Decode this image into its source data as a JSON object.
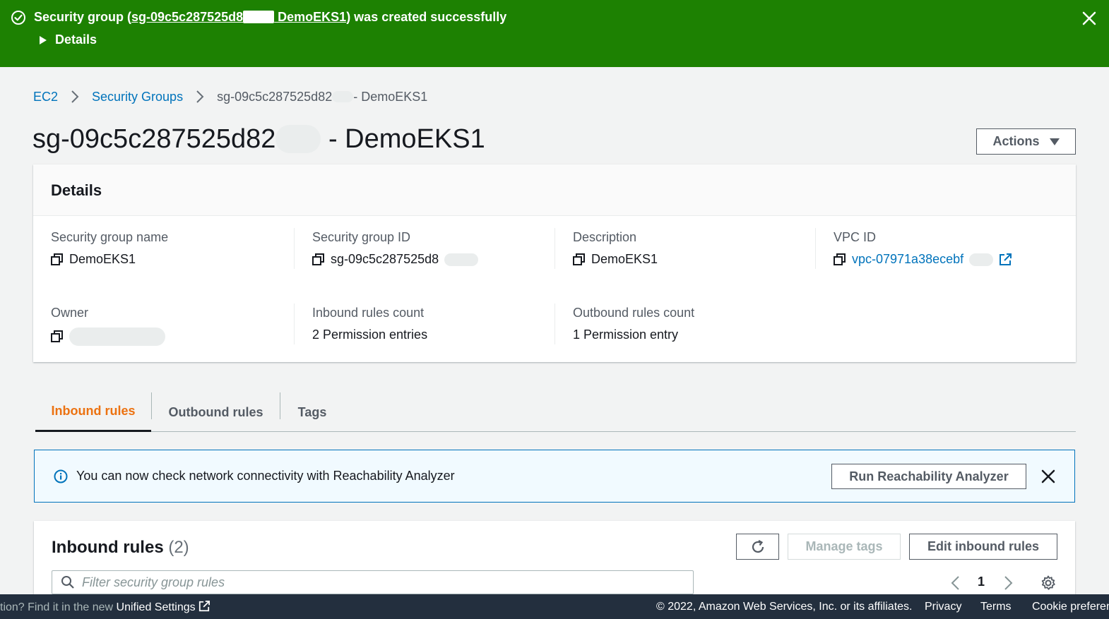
{
  "flash": {
    "prefix": "Security group (",
    "link_part1": "sg-09c5c287525d8",
    "link_part2": " DemoEKS1",
    "suffix": ") was created successfully",
    "details_label": "Details"
  },
  "breadcrumb": {
    "items": [
      "EC2",
      "Security Groups"
    ],
    "current_part1": "sg-09c5c287525d82",
    "current_part2": "- DemoEKS1"
  },
  "page": {
    "title_part1": "sg-09c5c287525d82",
    "title_part2": " - DemoEKS1",
    "actions_label": "Actions"
  },
  "details": {
    "heading": "Details",
    "fields": {
      "sg_name": {
        "label": "Security group name",
        "value": "DemoEKS1"
      },
      "sg_id": {
        "label": "Security group ID",
        "value": "sg-09c5c287525d8"
      },
      "description": {
        "label": "Description",
        "value": "DemoEKS1"
      },
      "vpc_id": {
        "label": "VPC ID",
        "value": "vpc-07971a38ecebf"
      },
      "owner": {
        "label": "Owner",
        "value": ""
      },
      "inbound_count": {
        "label": "Inbound rules count",
        "value": "2 Permission entries"
      },
      "outbound_count": {
        "label": "Outbound rules count",
        "value": "1 Permission entry"
      }
    }
  },
  "tabs": [
    {
      "label": "Inbound rules",
      "active": true
    },
    {
      "label": "Outbound rules",
      "active": false
    },
    {
      "label": "Tags",
      "active": false
    }
  ],
  "info_alert": {
    "message": "You can now check network connectivity with Reachability Analyzer",
    "button_label": "Run Reachability Analyzer"
  },
  "inbound_panel": {
    "title": "Inbound rules",
    "count": "(2)",
    "manage_tags_label": "Manage tags",
    "edit_label": "Edit inbound rules",
    "search_placeholder": "Filter security group rules",
    "page_number": "1"
  },
  "footer": {
    "left_text": "tion? Find it in the new ",
    "left_link": "Unified Settings",
    "copyright": "© 2022, Amazon Web Services, Inc. or its affiliates.",
    "privacy": "Privacy",
    "terms": "Terms",
    "cookie": "Cookie preferen"
  },
  "colors": {
    "success": "#1d8102",
    "link": "#0073bb",
    "active_tab": "#ec7211",
    "footer_bg": "#232f3e"
  }
}
